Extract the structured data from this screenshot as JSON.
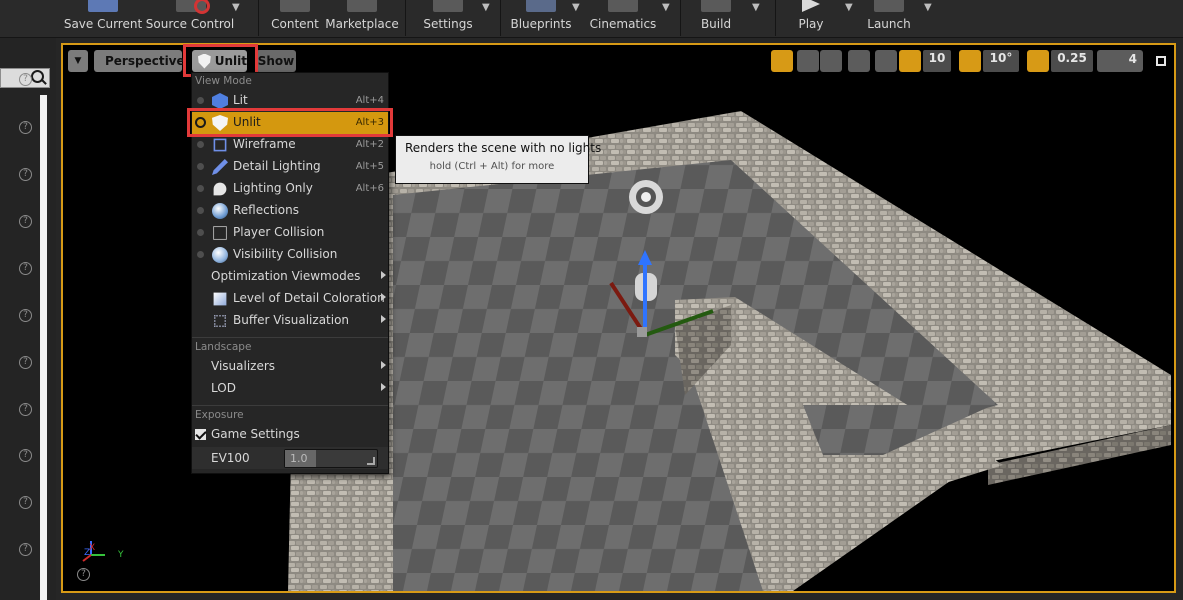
{
  "toolbar": {
    "buttons": [
      {
        "label": "Save Current"
      },
      {
        "label": "Source Control"
      },
      {
        "label": "Content"
      },
      {
        "label": "Marketplace"
      },
      {
        "label": "Settings"
      },
      {
        "label": "Blueprints"
      },
      {
        "label": "Cinematics"
      },
      {
        "label": "Build"
      },
      {
        "label": "Play"
      },
      {
        "label": "Launch"
      }
    ]
  },
  "left_panel": {
    "help_icon": "?"
  },
  "viewport": {
    "perspective_label": "Perspective",
    "view_mode_label": "Unlit",
    "show_label": "Show",
    "grid_snap_value": "10",
    "rotation_snap_value": "10°",
    "scale_snap_value": "0.25",
    "camera_speed_value": "4",
    "axis": {
      "x": "X",
      "y": "Y",
      "z": "Z"
    },
    "accent_color": "#d79a16"
  },
  "view_mode_menu": {
    "section_view_mode": "View Mode",
    "items": [
      {
        "label": "Lit",
        "shortcut": "Alt+4",
        "icon": "lit-cube-icon"
      },
      {
        "label": "Unlit",
        "shortcut": "Alt+3",
        "icon": "unlit-shield-icon",
        "selected": true
      },
      {
        "label": "Wireframe",
        "shortcut": "Alt+2",
        "icon": "wireframe-cube-icon"
      },
      {
        "label": "Detail Lighting",
        "shortcut": "Alt+5",
        "icon": "detail-lighting-icon"
      },
      {
        "label": "Lighting Only",
        "shortcut": "Alt+6",
        "icon": "lighting-only-icon"
      },
      {
        "label": "Reflections",
        "shortcut": "",
        "icon": "reflections-sphere-icon"
      },
      {
        "label": "Player Collision",
        "shortcut": "",
        "icon": "player-collision-icon"
      },
      {
        "label": "Visibility Collision",
        "shortcut": "",
        "icon": "visibility-collision-icon"
      }
    ],
    "submenus": [
      {
        "label": "Optimization Viewmodes"
      },
      {
        "label": "Level of Detail Coloration"
      },
      {
        "label": "Buffer Visualization"
      }
    ],
    "section_landscape": "Landscape",
    "landscape_items": [
      {
        "label": "Visualizers"
      },
      {
        "label": "LOD"
      }
    ],
    "section_exposure": "Exposure",
    "game_settings_label": "Game Settings",
    "game_settings_checked": true,
    "ev100_label": "EV100",
    "ev100_value": "1.0",
    "selected_color": "#d4980f"
  },
  "tooltip": {
    "title": "Renders the scene with no lights",
    "hint": "hold (Ctrl + Alt) for more"
  }
}
